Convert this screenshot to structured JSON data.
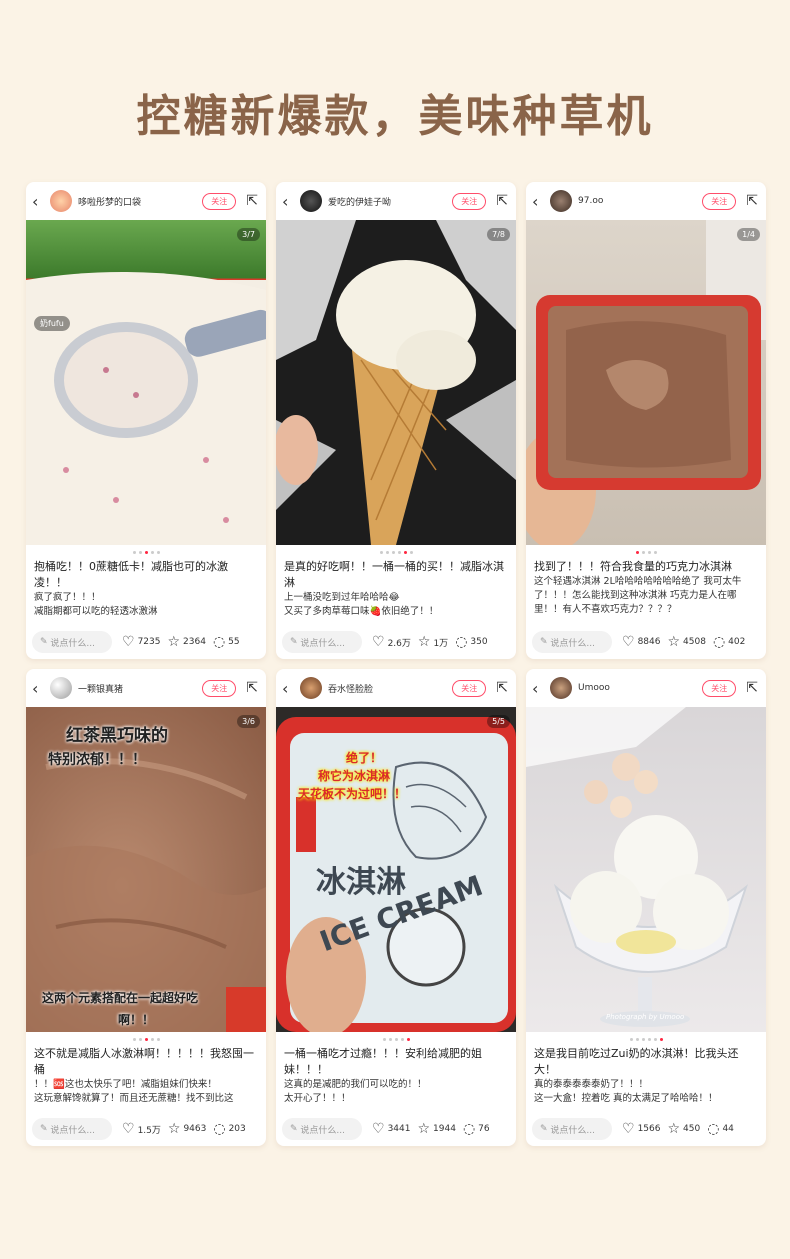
{
  "headline": "控糖新爆款，美味种草机",
  "follow_label": "关注",
  "comment_placeholder": "说点什么...",
  "cards": [
    {
      "username": "哆啦彤梦的口袋",
      "counter": "3/7",
      "tag": "奶fufu",
      "title": "抱桶吃！！0蔗糖低卡！减脂也可的冰激凌！！",
      "text1": "疯了疯了！！！",
      "text2": "减脂期都可以吃的轻透冰激淋",
      "likes": "7235",
      "collects": "2364",
      "comments": "55"
    },
    {
      "username": "爱吃的伊娃子呦",
      "counter": "7/8",
      "title": "是真的好吃啊！！一桶一桶的买！！减脂冰淇淋",
      "text1": "上一桶没吃到过年哈哈哈😂",
      "text2": "又买了多肉草莓口味🍓依旧绝了！！",
      "likes": "2.6万",
      "collects": "1万",
      "comments": "350"
    },
    {
      "username": "97.oo",
      "counter": "1/4",
      "title": "找到了！！！符合我食量的巧克力冰淇淋",
      "text1": "这个轻遇冰淇淋 2L哈哈哈哈哈哈哈绝了 我可太牛了！！！怎么能找到这种冰淇淋 巧克力是人在哪里！！有人不喜欢巧克力？？？？",
      "text2": "",
      "likes": "8846",
      "collects": "4508",
      "comments": "402"
    },
    {
      "username": "一颗银真猪",
      "counter": "3/6",
      "overlay_top1": "红茶黑巧味的",
      "overlay_top2": "特别浓郁！！！",
      "overlay_bottom1": "这两个元素搭配在一起超好吃",
      "overlay_bottom2": "啊！！",
      "title": "这不就是减脂人冰激淋啊！！！！！我怒囤一桶",
      "text1": "！！🆘这也太快乐了吧！减脂姐妹们快来！",
      "text2": "这玩意解馋就算了！而且还无蔗糖！找不到比这",
      "likes": "1.5万",
      "collects": "9463",
      "comments": "203"
    },
    {
      "username": "吞水怪脸脸",
      "counter": "5/5",
      "overlay_top1": "绝了！",
      "overlay_top2": "称它为冰淇淋",
      "overlay_top3": "天花板不为过吧！！",
      "package_text": "ICE CREAM",
      "package_sub": "冰淇淋",
      "title": "一桶一桶吃才过瘾！！！安利给减肥的姐妹！！！",
      "text1": "这真的是减肥的我们可以吃的！！",
      "text2": "太开心了！！！",
      "likes": "3441",
      "collects": "1944",
      "comments": "76"
    },
    {
      "username": "Umooo",
      "counter": "",
      "watermark": "Photograph by Umooo",
      "title": "这是我目前吃过Zui奶的冰淇淋！比我头还大！",
      "text1": "真的泰泰泰泰泰奶了！！！",
      "text2": "这一大盒！控着吃 真的太满足了哈哈哈！！",
      "likes": "1566",
      "collects": "450",
      "comments": "44"
    }
  ]
}
